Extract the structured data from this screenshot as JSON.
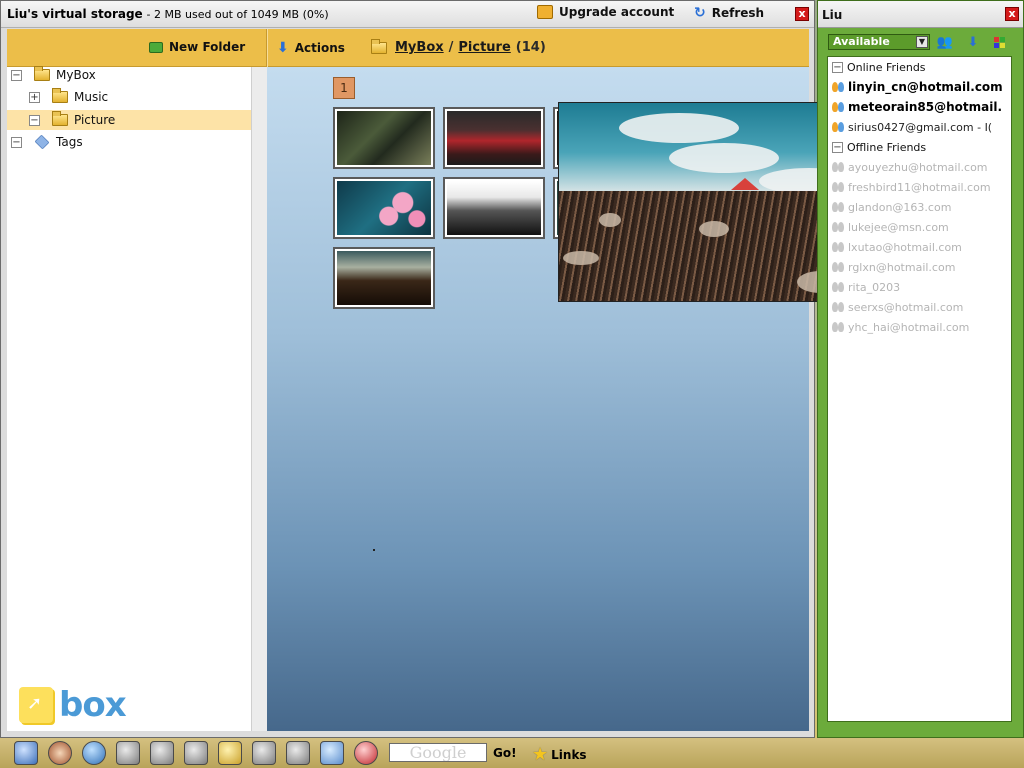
{
  "main_window": {
    "title": "Liu's virtual storage",
    "usage": "- 2 MB used out of 1049 MB (0%)",
    "upgrade_label": "Upgrade account",
    "refresh_label": "Refresh",
    "close_label": "x"
  },
  "toolbar": {
    "new_folder_label": "New Folder",
    "actions_label": "Actions",
    "breadcrumb": {
      "root": "MyBox",
      "separator": "/",
      "current": "Picture",
      "count": "(14)"
    }
  },
  "tree": {
    "items": [
      {
        "label": "MyBox",
        "expander": "−"
      },
      {
        "label": "Music",
        "expander": "+"
      },
      {
        "label": "Picture",
        "expander": "−"
      },
      {
        "label": "Tags",
        "expander": "−"
      }
    ]
  },
  "logo": {
    "text": "box"
  },
  "gallery": {
    "page_number": "1",
    "thumbnails": [
      {
        "name": "forest-swing"
      },
      {
        "name": "red-field"
      },
      {
        "name": "dark-partial"
      },
      {
        "name": "pink-flowers"
      },
      {
        "name": "bw-field"
      },
      {
        "name": "partial-2"
      },
      {
        "name": "sunset-field"
      }
    ]
  },
  "preview": {
    "name": "grass-field-preview"
  },
  "friends_window": {
    "title": "Liu",
    "status": "Available",
    "groups": {
      "online": "Online Friends",
      "offline": "Offline Friends"
    },
    "online": [
      "linyin_cn@hotmail.com",
      "meteorain85@hotmail.",
      "sirius0427@gmail.com - I("
    ],
    "offline": [
      "ayouyezhu@hotmail.com",
      "freshbird11@hotmail.com",
      "glandon@163.com",
      "lukejee@msn.com",
      "lxutao@hotmail.com",
      "rglxn@hotmail.com",
      "rita_0203",
      "seerxs@hotmail.com",
      "yhc_hai@hotmail.com"
    ]
  },
  "taskbar": {
    "search_placeholder": "Google",
    "go_label": "Go!",
    "links_label": "Links"
  }
}
